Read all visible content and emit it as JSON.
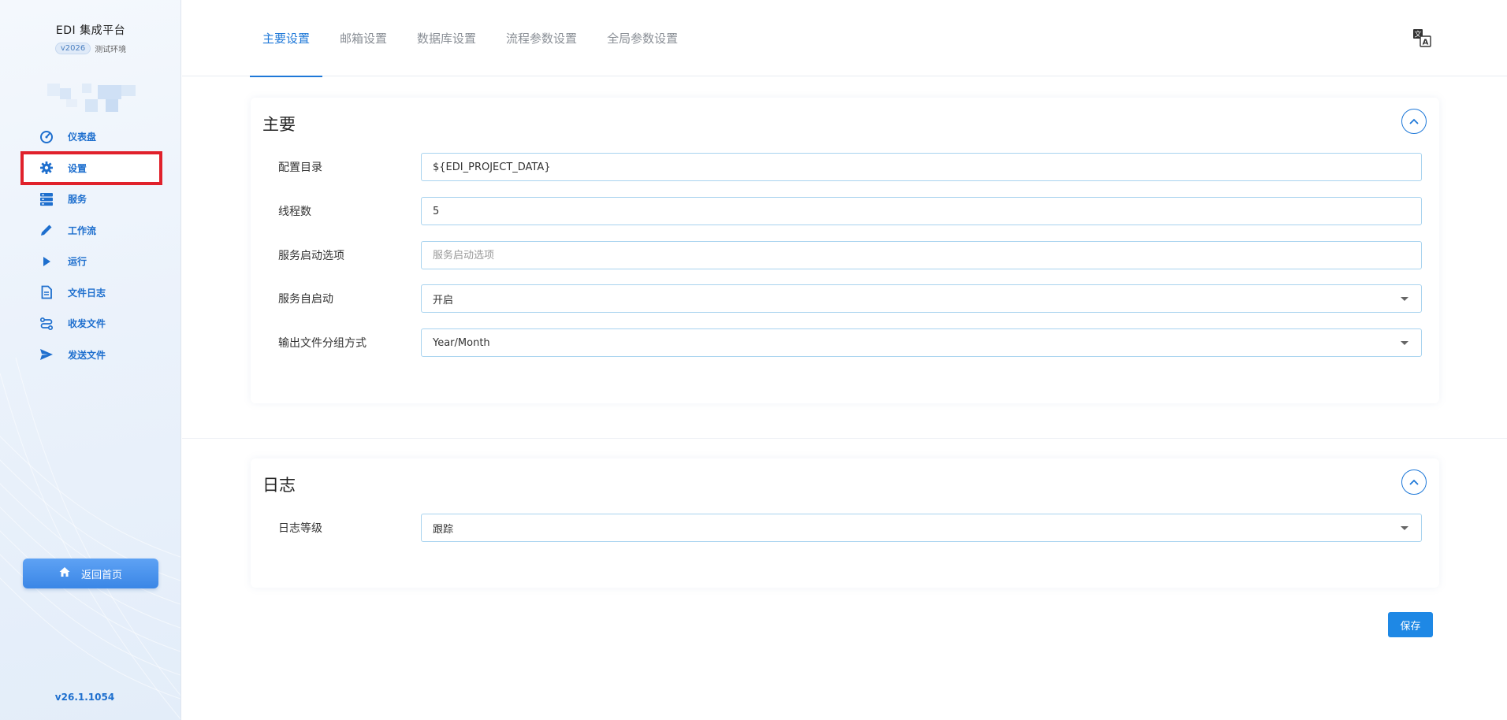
{
  "sidebar": {
    "brand_title": "EDI 集成平台",
    "version_badge": "v2026",
    "environment": "测试环境",
    "items": [
      {
        "label": "仪表盘",
        "icon": "speedometer-icon"
      },
      {
        "label": "设置",
        "icon": "gear-icon"
      },
      {
        "label": "服务",
        "icon": "server-icon"
      },
      {
        "label": "工作流",
        "icon": "pencil-icon"
      },
      {
        "label": "运行",
        "icon": "play-icon"
      },
      {
        "label": "文件日志",
        "icon": "file-document-icon"
      },
      {
        "label": "收发文件",
        "icon": "transfer-icon"
      },
      {
        "label": "发送文件",
        "icon": "send-icon"
      }
    ],
    "home_button": "返回首页",
    "app_version": "v26.1.1054"
  },
  "tabs": [
    "主要设置",
    "邮箱设置",
    "数据库设置",
    "流程参数设置",
    "全局参数设置"
  ],
  "active_tab": "主要设置",
  "main_section": {
    "title": "主要",
    "fields": {
      "config_dir": {
        "label": "配置目录",
        "value": "${EDI_PROJECT_DATA}"
      },
      "thread_count": {
        "label": "线程数",
        "value": "5"
      },
      "service_start_options": {
        "label": "服务启动选项",
        "value": "",
        "placeholder": "服务启动选项"
      },
      "service_autostart": {
        "label": "服务自启动",
        "value": "开启"
      },
      "output_grouping": {
        "label": "输出文件分组方式",
        "value": "Year/Month"
      }
    }
  },
  "log_section": {
    "title": "日志",
    "fields": {
      "log_level": {
        "label": "日志等级",
        "value": "跟踪"
      }
    }
  },
  "save_button": "保存",
  "colors": {
    "accent": "#1e78d8",
    "selected_outline": "#e0212b",
    "field_border": "#a8d3ef"
  }
}
